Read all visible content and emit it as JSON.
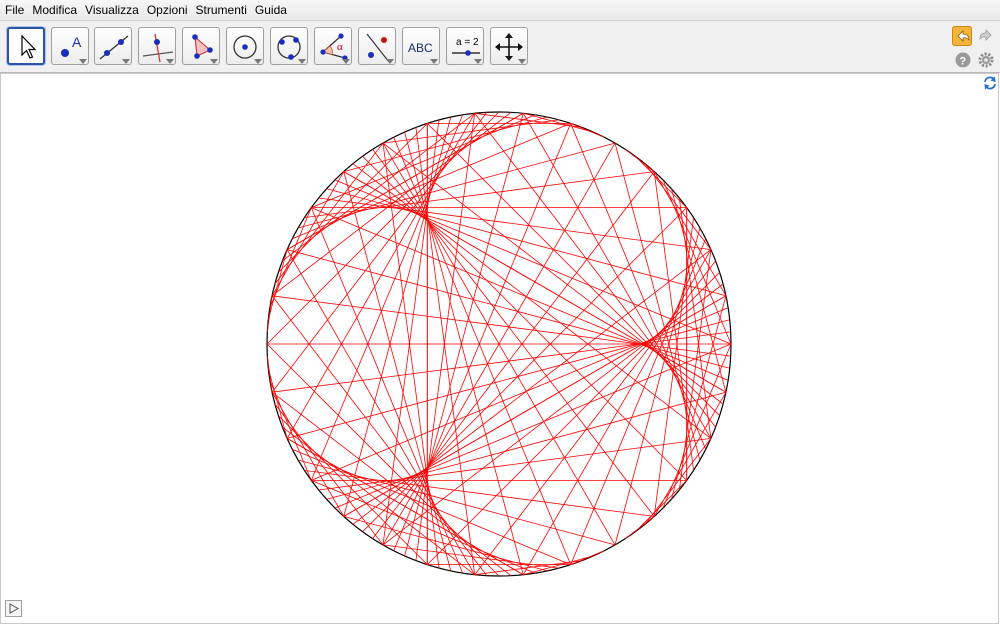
{
  "menu": [
    "File",
    "Modifica",
    "Visualizza",
    "Opzioni",
    "Strumenti",
    "Guida"
  ],
  "toolbar": {
    "tools": [
      {
        "name": "move-tool",
        "icon": "arrow-pointer-icon"
      },
      {
        "name": "new-point-tool",
        "icon": "point-icon"
      },
      {
        "name": "line-tool",
        "icon": "line-through-points-icon"
      },
      {
        "name": "perpendicular-line-tool",
        "icon": "perpendicular-line-icon"
      },
      {
        "name": "polygon-tool",
        "icon": "polygon-icon"
      },
      {
        "name": "circle-center-point-tool",
        "icon": "circle-center-icon"
      },
      {
        "name": "circle-three-points-tool",
        "icon": "circle-three-points-icon"
      },
      {
        "name": "angle-tool",
        "icon": "angle-icon"
      },
      {
        "name": "reflect-tool",
        "icon": "reflect-about-line-icon"
      },
      {
        "name": "text-tool",
        "icon": "text-icon"
      },
      {
        "name": "slider-tool",
        "icon": "slider-icon"
      },
      {
        "name": "move-graphics-view-tool",
        "icon": "move-view-icon"
      }
    ],
    "text_tool_label": "ABC",
    "slider_tool_label": "a = 2",
    "angle_tool_label": "α"
  },
  "drawing": {
    "circle_color": "#000000",
    "curve_color": "#ff0000",
    "chord_count": 120,
    "multiplier": 4
  },
  "colors": {
    "accent": "#2b56a6",
    "undo": "#f2b53c"
  }
}
